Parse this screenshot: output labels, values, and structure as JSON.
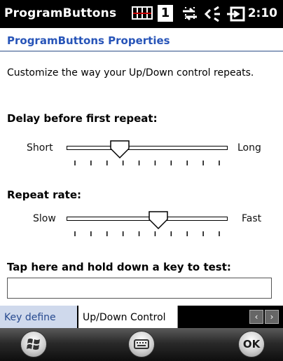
{
  "status_bar": {
    "app_title": "ProgramButtons",
    "badge": "1",
    "time": "2:10"
  },
  "page": {
    "title": "ProgramButtons Properties",
    "description": "Customize the way your Up/Down control repeats."
  },
  "delay": {
    "title": "Delay before first repeat:",
    "min_label": "Short",
    "max_label": "Long",
    "value_fraction": 0.33
  },
  "repeat_rate": {
    "title": "Repeat rate:",
    "min_label": "Slow",
    "max_label": "Fast",
    "value_fraction": 0.57
  },
  "test": {
    "title": "Tap here and hold down a key to test:",
    "value": ""
  },
  "tabs": [
    {
      "label": "Key define"
    },
    {
      "label": "Up/Down Control"
    }
  ],
  "softkeys": {
    "ok": "OK"
  }
}
